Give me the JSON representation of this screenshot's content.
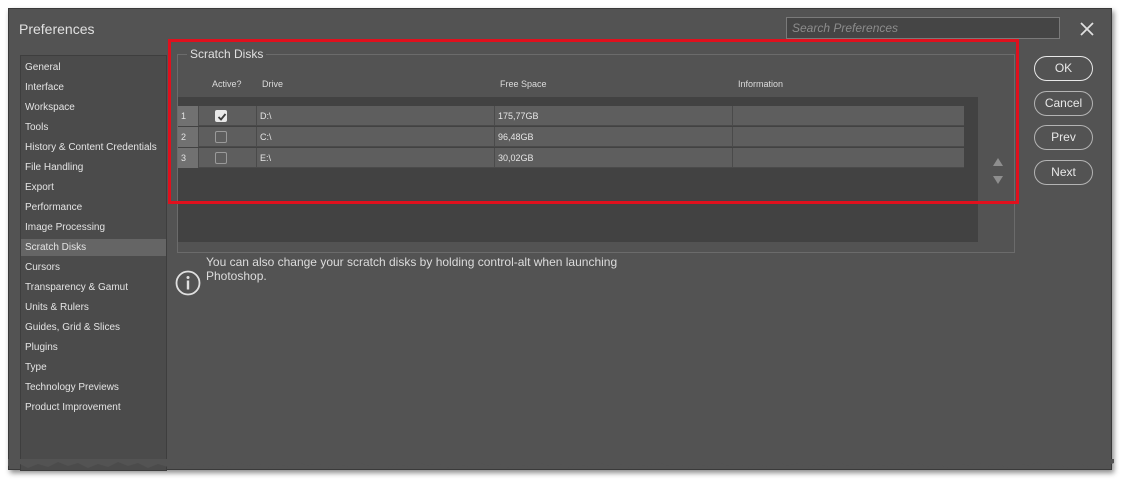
{
  "dialog": {
    "title": "Preferences",
    "search_placeholder": "Search Preferences"
  },
  "sidebar": {
    "selected": "Scratch Disks",
    "items": [
      {
        "label": "General"
      },
      {
        "label": "Interface"
      },
      {
        "label": "Workspace"
      },
      {
        "label": "Tools"
      },
      {
        "label": "History & Content Credentials"
      },
      {
        "label": "File Handling"
      },
      {
        "label": "Export"
      },
      {
        "label": "Performance"
      },
      {
        "label": "Image Processing"
      },
      {
        "label": "Scratch Disks"
      },
      {
        "label": "Cursors"
      },
      {
        "label": "Transparency & Gamut"
      },
      {
        "label": "Units & Rulers"
      },
      {
        "label": "Guides, Grid & Slices"
      },
      {
        "label": "Plugins"
      },
      {
        "label": "Type"
      },
      {
        "label": "Technology Previews"
      },
      {
        "label": "Product Improvement"
      }
    ]
  },
  "scratch_disks": {
    "group_title": "Scratch Disks",
    "columns": {
      "active": "Active?",
      "drive": "Drive",
      "free_space": "Free Space",
      "information": "Information"
    },
    "rows": [
      {
        "index": "1",
        "active": true,
        "drive": "D:\\",
        "free_space": "175,77GB",
        "information": ""
      },
      {
        "index": "2",
        "active": false,
        "drive": "C:\\",
        "free_space": "96,48GB",
        "information": ""
      },
      {
        "index": "3",
        "active": false,
        "drive": "E:\\",
        "free_space": "30,02GB",
        "information": ""
      }
    ],
    "info_text": "You can also change your scratch disks by holding control-alt when launching Photoshop."
  },
  "buttons": {
    "ok": "OK",
    "cancel": "Cancel",
    "prev": "Prev",
    "next": "Next"
  },
  "colors": {
    "highlight_box": "#e0101d",
    "dialog_background": "#535353"
  }
}
